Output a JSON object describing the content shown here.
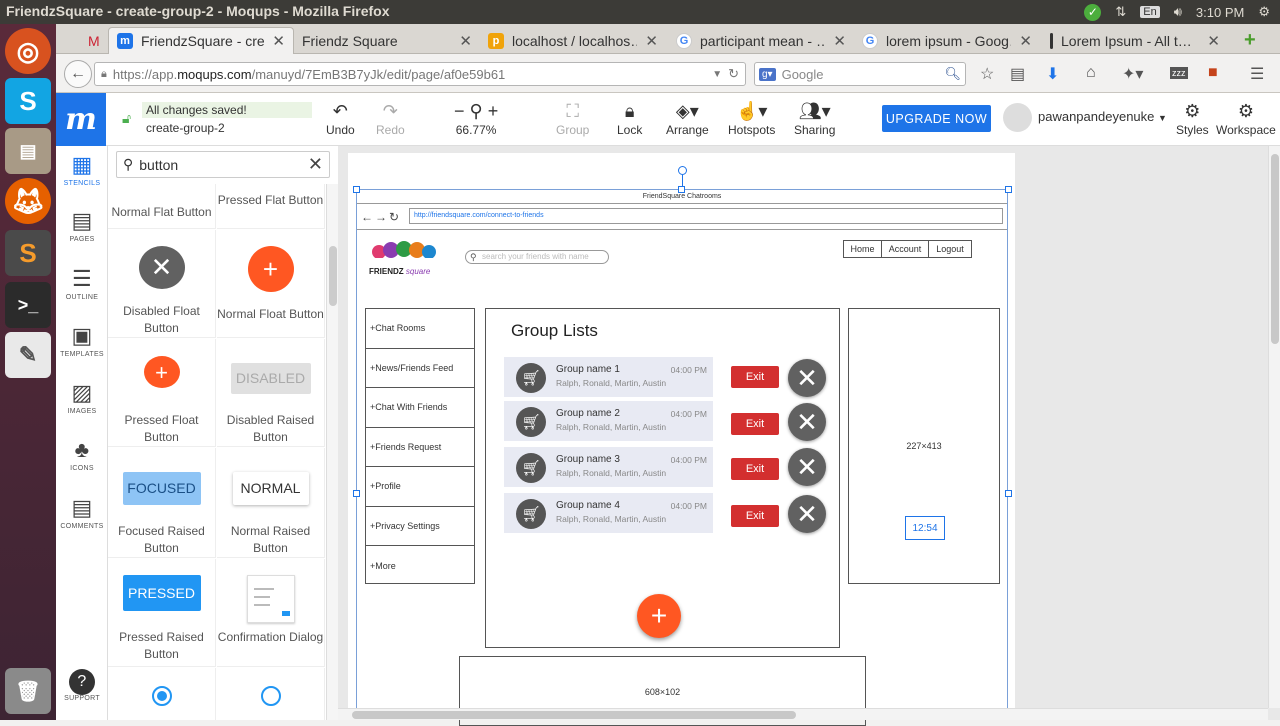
{
  "os": {
    "window_title": "FriendzSquare - create-group-2 - Moqups - Mozilla Firefox",
    "lang": "En",
    "time": "3:10 PM"
  },
  "browser": {
    "tabs": [
      {
        "label": "FriendzSquare - cre…",
        "fav": "m",
        "fav_color": "#1e74e8"
      },
      {
        "label": "Friendz Square",
        "fav": "",
        "fav_color": ""
      },
      {
        "label": "localhost / localhos…",
        "fav": "p",
        "fav_color": "#f0a30a"
      },
      {
        "label": "participant mean - …",
        "fav": "G",
        "fav_color": "#ffffff"
      },
      {
        "label": "lorem ipsum - Goog…",
        "fav": "G",
        "fav_color": "#ffffff"
      },
      {
        "label": "Lorem Ipsum - All t…",
        "fav": "",
        "fav_color": ""
      }
    ],
    "url_prefix": "https://app.",
    "url_domain": "moqups.com",
    "url_rest": "/manuyd/7EmB3B7yJk/edit/page/af0e59b61",
    "search_placeholder": "Google"
  },
  "toolbar": {
    "saved_status": "All changes saved!",
    "doc_name": "create-group-2",
    "undo": "Undo",
    "redo": "Redo",
    "zoom": "66.77%",
    "group": "Group",
    "lock": "Lock",
    "arrange": "Arrange",
    "hotspots": "Hotspots",
    "sharing": "Sharing",
    "upgrade": "UPGRADE NOW",
    "username": "pawanpandeyenuke",
    "styles": "Styles",
    "workspace": "Workspace"
  },
  "rail": {
    "stencils": "STENCILS",
    "pages": "PAGES",
    "outline": "OUTLINE",
    "templates": "TEMPLATES",
    "images": "IMAGES",
    "icons": "ICONS",
    "comments": "COMMENTS",
    "support": "SUPPORT"
  },
  "stencil": {
    "search_value": "button",
    "items": [
      {
        "label": "Normal Flat Button"
      },
      {
        "label": "Pressed Flat Button"
      },
      {
        "label": "Disabled Float Button"
      },
      {
        "label": "Normal Float Button"
      },
      {
        "label": "Pressed Float Button"
      },
      {
        "label": "Disabled Raised Button",
        "preview": "DISABLED"
      },
      {
        "label": "Focused Raised Button",
        "preview": "FOCUSED"
      },
      {
        "label": "Normal Raised Button",
        "preview": "NORMAL"
      },
      {
        "label": "Pressed Raised Button",
        "preview": "PRESSED"
      },
      {
        "label": "Confirmation Dialog"
      }
    ]
  },
  "mockup": {
    "frame_title": "FriendSquare Chatrooms",
    "frame_url": "http://friendsquare.com/connect-to-friends",
    "logo_text": "FRIENDZ",
    "logo_sub": "square",
    "search_placeholder": "search your friends with name",
    "nav": [
      "Home",
      "Account",
      "Logout"
    ],
    "menu": [
      "+Chat Rooms",
      "+News/Friends Feed",
      "+Chat With Friends",
      "+Friends Request",
      "+Profile",
      "+Privacy Settings",
      "+More"
    ],
    "group_title": "Group Lists",
    "groups": [
      {
        "name": "Group name 1",
        "time": "04:00 PM",
        "members": "Ralph, Ronald, Martin, Austin"
      },
      {
        "name": "Group name 2",
        "time": "04:00 PM",
        "members": "Ralph, Ronald, Martin, Austin"
      },
      {
        "name": "Group name 3",
        "time": "04:00 PM",
        "members": "Ralph, Ronald, Martin, Austin"
      },
      {
        "name": "Group name 4",
        "time": "04:00 PM",
        "members": "Ralph, Ronald, Martin, Austin"
      }
    ],
    "exit_label": "Exit",
    "right_box_size": "227×413",
    "right_box_time": "12:54",
    "bottom_box_size": "608×102"
  },
  "colors": {
    "brand": "#1e74e8",
    "fab": "#ff5722",
    "exit": "#d32f2f"
  }
}
